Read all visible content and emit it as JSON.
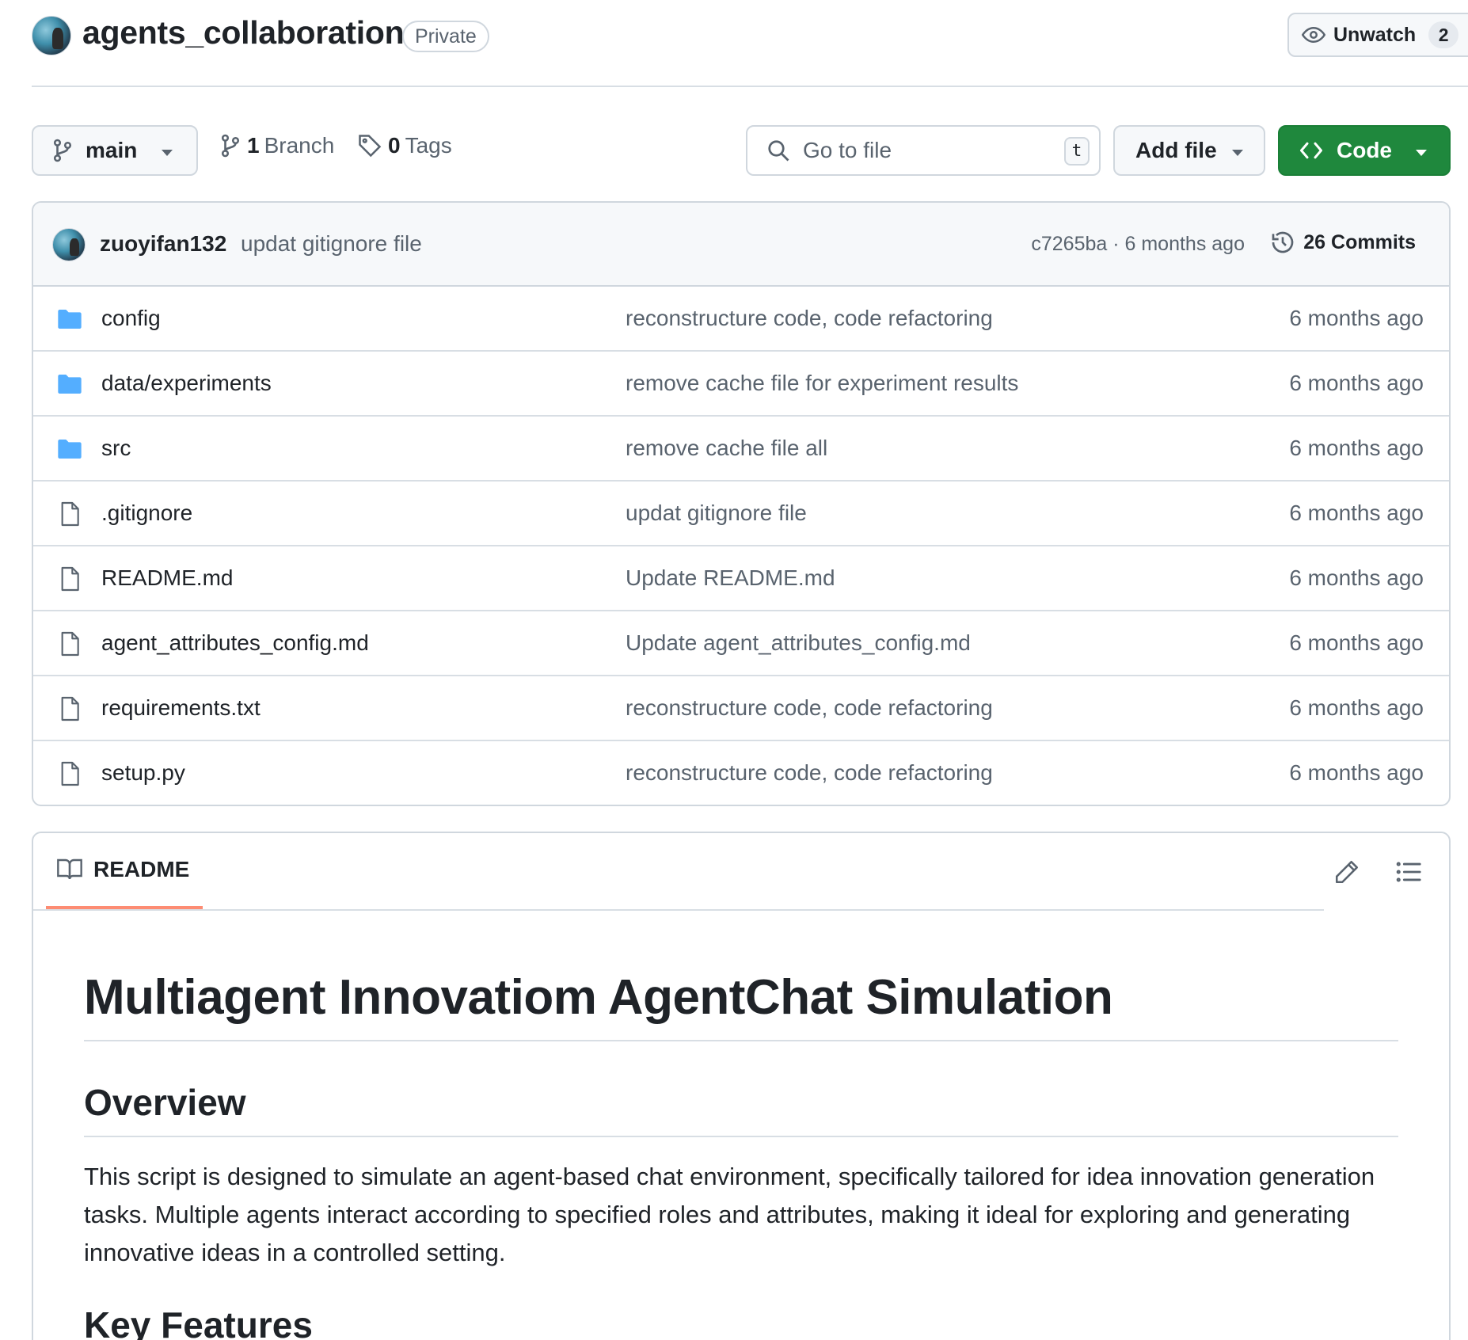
{
  "repo": {
    "name": "agents_collaboration",
    "visibility": "Private",
    "watch_label": "Unwatch",
    "watch_count": "2"
  },
  "toolbar": {
    "branch": "main",
    "branch_count": "1",
    "branch_label": "Branch",
    "tag_count": "0",
    "tag_label": "Tags",
    "search_placeholder": "Go to file",
    "search_shortcut": "t",
    "add_file_label": "Add file",
    "code_label": "Code",
    "code_color": "#1f883d"
  },
  "latest_commit": {
    "author": "zuoyifan132",
    "message": "updat gitignore file",
    "hash_time": "c7265ba · 6 months ago",
    "commits_label": "26 Commits"
  },
  "files": [
    {
      "name": "config",
      "type": "folder",
      "commit": "reconstructure code, code refactoring",
      "time": "6 months ago"
    },
    {
      "name": "data/experiments",
      "type": "folder",
      "commit": "remove cache file for experiment results",
      "time": "6 months ago"
    },
    {
      "name": "src",
      "type": "folder",
      "commit": "remove cache file all",
      "time": "6 months ago"
    },
    {
      "name": ".gitignore",
      "type": "file",
      "commit": "updat gitignore file",
      "time": "6 months ago"
    },
    {
      "name": "README.md",
      "type": "file",
      "commit": "Update README.md",
      "time": "6 months ago"
    },
    {
      "name": "agent_attributes_config.md",
      "type": "file",
      "commit": "Update agent_attributes_config.md",
      "time": "6 months ago"
    },
    {
      "name": "requirements.txt",
      "type": "file",
      "commit": "reconstructure code, code refactoring",
      "time": "6 months ago"
    },
    {
      "name": "setup.py",
      "type": "file",
      "commit": "reconstructure code, code refactoring",
      "time": "6 months ago"
    }
  ],
  "readme": {
    "tab_label": "README",
    "title": "Multiagent Innovatiom AgentChat Simulation",
    "overview_heading": "Overview",
    "overview_text": "This script is designed to simulate an agent-based chat environment, specifically tailored for idea innovation generation tasks. Multiple agents interact according to specified roles and attributes, making it ideal for exploring and generating innovative ideas in a controlled setting.",
    "next_heading": "Key Features"
  },
  "icons": {
    "folder_color": "#54aeff",
    "tab_underline_color": "#fd8c73"
  }
}
